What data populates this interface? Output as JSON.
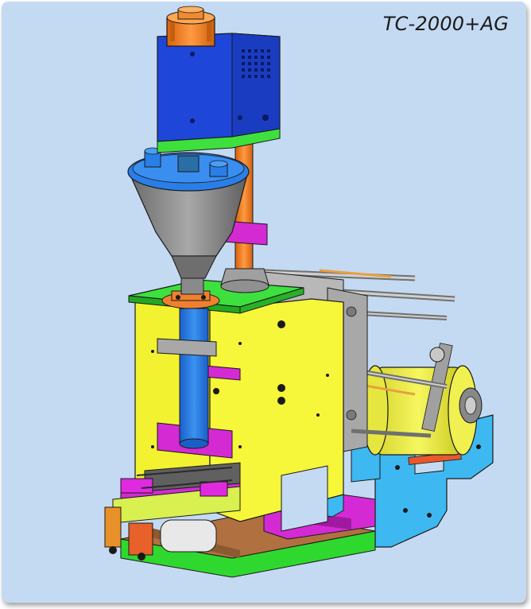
{
  "model_label": "TC-2000+AG",
  "colors": {
    "background": "#c4daf2",
    "frame_yellow": "#f2f230",
    "motor_blue": "#1e46d8",
    "auger_blue": "#2a7ee8",
    "hopper_gray": "#8a8a8a",
    "magenta": "#d42ad4",
    "orange": "#f0802a",
    "green": "#3ee03e",
    "cyan": "#3eb8f0",
    "steel": "#b8b8b8"
  }
}
